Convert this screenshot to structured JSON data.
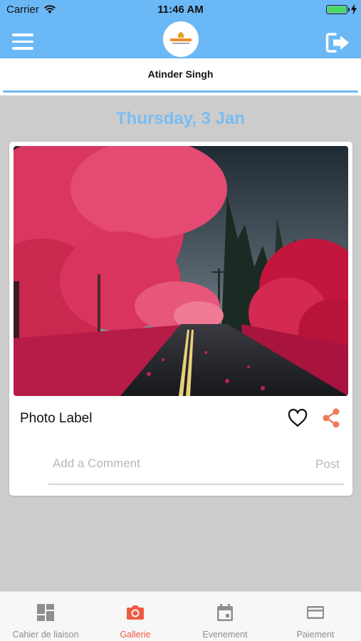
{
  "status_bar": {
    "carrier": "Carrier",
    "time": "11:46 AM",
    "battery_level_percent": 100
  },
  "header": {
    "menu_icon": "hamburger-menu-icon",
    "logo_icon": "school-logo-icon",
    "logout_icon": "logout-icon",
    "accent_color": "#6bb8f6"
  },
  "user": {
    "name": "Atinder Singh"
  },
  "feed": {
    "date": "Thursday, 3 Jan",
    "post": {
      "photo_icon": "autumn-road-photo",
      "label": "Photo Label",
      "like_icon": "heart-outline-icon",
      "share_icon": "share-icon",
      "comment_placeholder": "Add a Comment",
      "post_label": "Post"
    }
  },
  "tabbar": {
    "active_color": "#f05a45",
    "inactive_color": "#8e8e93",
    "tabs": [
      {
        "label": "Cahier de liaison",
        "icon": "dashboard-icon",
        "active": false
      },
      {
        "label": "Gallerie",
        "icon": "camera-icon",
        "active": true
      },
      {
        "label": "Evenement",
        "icon": "calendar-icon",
        "active": false
      },
      {
        "label": "Paiement",
        "icon": "credit-card-icon",
        "active": false
      }
    ]
  }
}
